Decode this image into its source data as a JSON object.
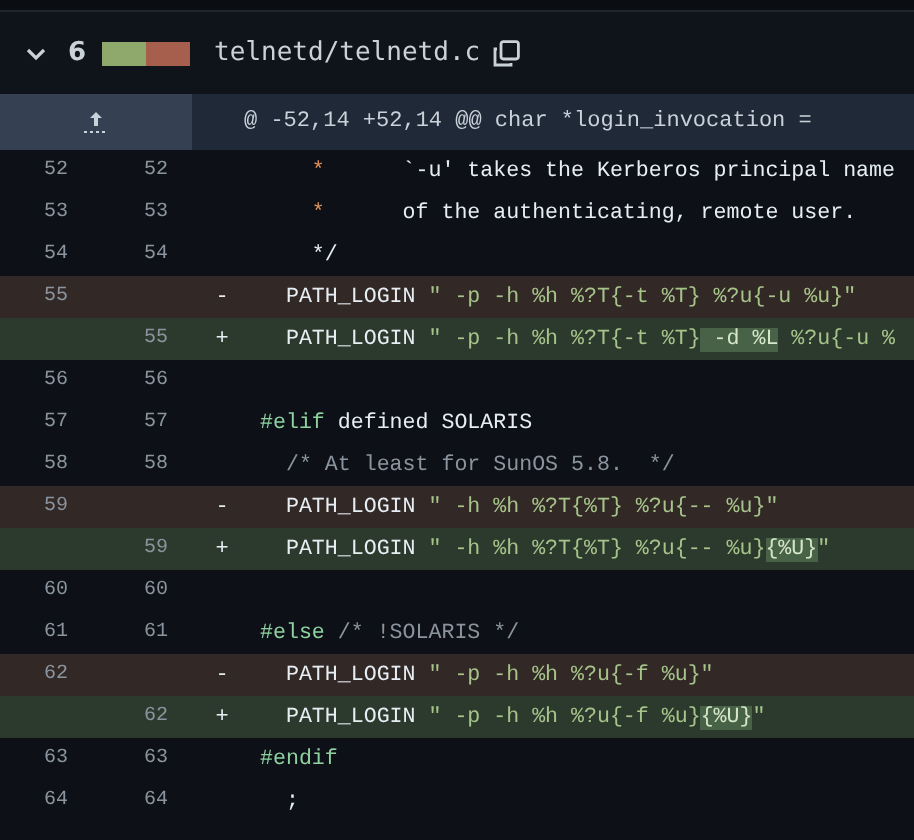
{
  "file_header": {
    "expanded": true,
    "changes": "6",
    "diffstat": [
      {
        "color": "#8fa86b"
      },
      {
        "color": "#a65f4d"
      }
    ],
    "filename": "telnetd/telnetd.c"
  },
  "hunk": {
    "header": "@ -52,14 +52,14 @@ char *login_invocation ="
  },
  "rows": [
    {
      "kind": "context",
      "old": "52",
      "new": "52",
      "segments": [
        {
          "text": "    *",
          "kind": "star"
        },
        {
          "text": "      `-u' takes the Kerberos principal name",
          "kind": "plain"
        }
      ]
    },
    {
      "kind": "context",
      "old": "53",
      "new": "53",
      "segments": [
        {
          "text": "    *",
          "kind": "star"
        },
        {
          "text": "      of the authenticating, remote user.",
          "kind": "plain"
        }
      ]
    },
    {
      "kind": "context",
      "old": "54",
      "new": "54",
      "segments": [
        {
          "text": "    */",
          "kind": "plain"
        }
      ]
    },
    {
      "kind": "deleted",
      "old": "55",
      "sign": "-",
      "segments": [
        {
          "text": "  PATH_LOGIN ",
          "kind": "plain"
        },
        {
          "text": "\" -p -h %h %?T{-t %T} %?u{-u %u}\"",
          "kind": "string"
        }
      ]
    },
    {
      "kind": "added",
      "new": "55",
      "sign": "+",
      "segments": [
        {
          "text": "  PATH_LOGIN ",
          "kind": "plain"
        },
        {
          "text": "\" -p -h %h %?T{-t %T}",
          "kind": "string"
        },
        {
          "text": " -d %L",
          "kind": "highlight"
        },
        {
          "text": " %?u{-u %",
          "kind": "string"
        }
      ]
    },
    {
      "kind": "context",
      "old": "56",
      "new": "56",
      "segments": []
    },
    {
      "kind": "context",
      "old": "57",
      "new": "57",
      "segments": [
        {
          "text": "#elif",
          "kind": "directive"
        },
        {
          "text": " defined SOLARIS",
          "kind": "plain"
        }
      ]
    },
    {
      "kind": "context",
      "old": "58",
      "new": "58",
      "segments": [
        {
          "text": "  /* At least for SunOS 5.8.  */",
          "kind": "comment"
        }
      ]
    },
    {
      "kind": "deleted",
      "old": "59",
      "sign": "-",
      "segments": [
        {
          "text": "  PATH_LOGIN ",
          "kind": "plain"
        },
        {
          "text": "\" -h %h %?T{%T} %?u{-- %u}\"",
          "kind": "string"
        }
      ]
    },
    {
      "kind": "added",
      "new": "59",
      "sign": "+",
      "segments": [
        {
          "text": "  PATH_LOGIN ",
          "kind": "plain"
        },
        {
          "text": "\" -h %h %?T{%T} %?u{-- %u}",
          "kind": "string"
        },
        {
          "text": "{%U}",
          "kind": "highlight"
        },
        {
          "text": "\"",
          "kind": "string"
        }
      ]
    },
    {
      "kind": "context",
      "old": "60",
      "new": "60",
      "segments": []
    },
    {
      "kind": "context",
      "old": "61",
      "new": "61",
      "segments": [
        {
          "text": "#else",
          "kind": "directive"
        },
        {
          "text": " /* !SOLARIS */",
          "kind": "comment"
        }
      ]
    },
    {
      "kind": "deleted",
      "old": "62",
      "sign": "-",
      "segments": [
        {
          "text": "  PATH_LOGIN ",
          "kind": "plain"
        },
        {
          "text": "\" -p -h %h %?u{-f %u}\"",
          "kind": "string"
        }
      ]
    },
    {
      "kind": "added",
      "new": "62",
      "sign": "+",
      "segments": [
        {
          "text": "  PATH_LOGIN ",
          "kind": "plain"
        },
        {
          "text": "\" -p -h %h %?u{-f %u}",
          "kind": "string"
        },
        {
          "text": "{%U}",
          "kind": "highlight"
        },
        {
          "text": "\"",
          "kind": "string"
        }
      ]
    },
    {
      "kind": "context",
      "old": "63",
      "new": "63",
      "segments": [
        {
          "text": "#endif",
          "kind": "directive"
        }
      ]
    },
    {
      "kind": "context",
      "old": "64",
      "new": "64",
      "segments": [
        {
          "text": "  ;",
          "kind": "plain"
        }
      ]
    }
  ]
}
